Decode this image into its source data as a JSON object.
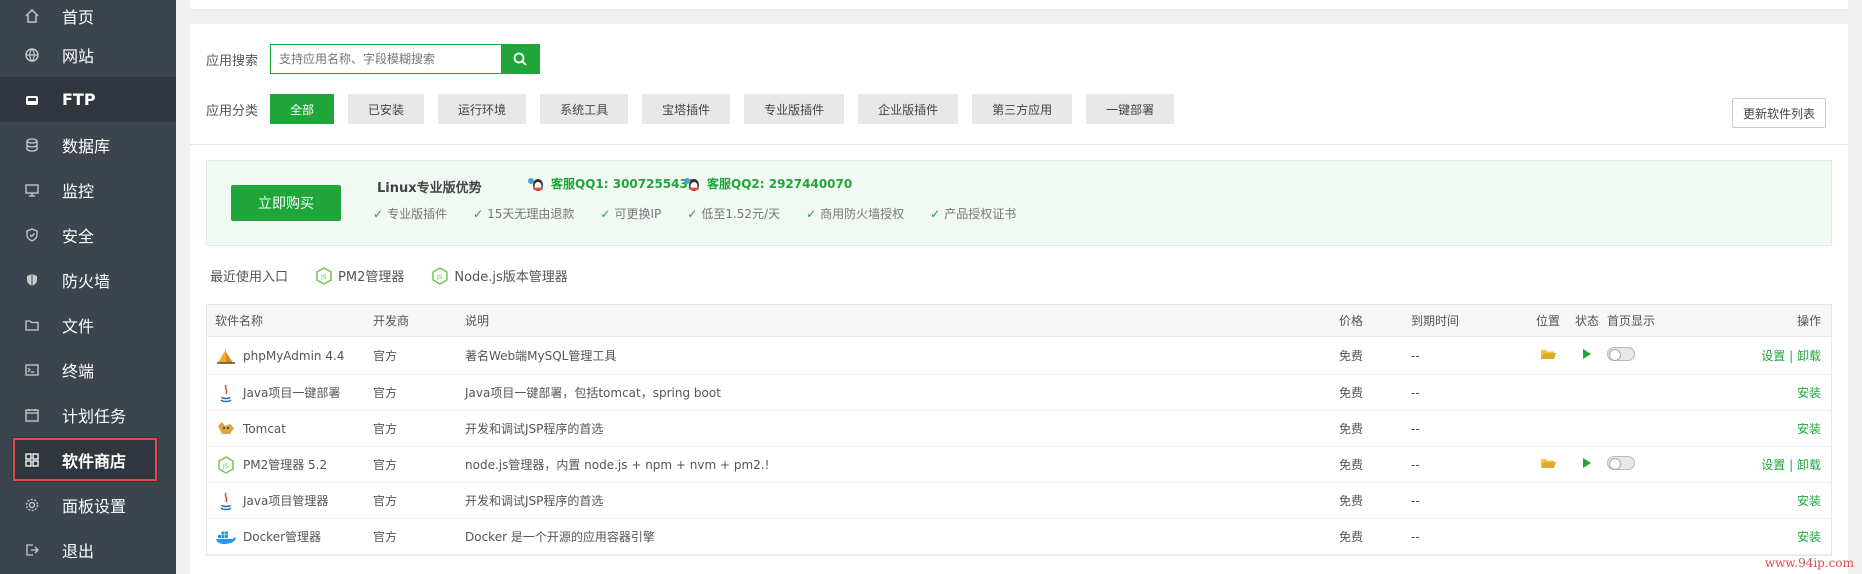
{
  "sidebar": {
    "items": [
      {
        "label": "首页",
        "icon": "home-icon"
      },
      {
        "label": "网站",
        "icon": "globe-icon"
      },
      {
        "label": "FTP",
        "icon": "ftp-icon"
      },
      {
        "label": "数据库",
        "icon": "database-icon"
      },
      {
        "label": "监控",
        "icon": "monitor-icon"
      },
      {
        "label": "安全",
        "icon": "shield-icon"
      },
      {
        "label": "防火墙",
        "icon": "firewall-icon"
      },
      {
        "label": "文件",
        "icon": "folder-icon"
      },
      {
        "label": "终端",
        "icon": "terminal-icon"
      },
      {
        "label": "计划任务",
        "icon": "calendar-icon"
      },
      {
        "label": "软件商店",
        "icon": "grid-icon"
      },
      {
        "label": "面板设置",
        "icon": "gear-icon"
      },
      {
        "label": "退出",
        "icon": "logout-icon"
      }
    ]
  },
  "search": {
    "label": "应用搜索",
    "placeholder": "支持应用名称、字段模糊搜索"
  },
  "categories": {
    "label": "应用分类",
    "items": [
      "全部",
      "已安装",
      "运行环境",
      "系统工具",
      "宝塔插件",
      "专业版插件",
      "企业版插件",
      "第三方应用",
      "一键部署"
    ],
    "selected": "全部"
  },
  "refresh_label": "更新软件列表",
  "promo": {
    "buy_label": "立即购买",
    "title": "Linux专业版优势",
    "qq1": "客服QQ1: 3007255432",
    "qq2": "客服QQ2: 2927440070",
    "perks": [
      "专业版插件",
      "15天无理由退款",
      "可更换IP",
      "低至1.52元/天",
      "商用防火墙授权",
      "产品授权证书"
    ]
  },
  "recent": {
    "label": "最近使用入口",
    "items": [
      "PM2管理器",
      "Node.js版本管理器"
    ]
  },
  "table": {
    "headers": {
      "name": "软件名称",
      "dev": "开发商",
      "desc": "说明",
      "price": "价格",
      "expire": "到期时间",
      "pos": "位置",
      "state": "状态",
      "home": "首页显示",
      "op": "操作"
    },
    "rows": [
      {
        "name": "phpMyAdmin 4.4",
        "dev": "官方",
        "desc": "著名Web端MySQL管理工具",
        "price": "免费",
        "expire": "--",
        "installed": true,
        "op1": "设置",
        "sep": "|",
        "op2": "卸载"
      },
      {
        "name": "Java项目一键部署",
        "dev": "官方",
        "desc": "Java项目一键部署，包括tomcat，spring boot",
        "price": "免费",
        "expire": "--",
        "installed": false,
        "op1": "安装"
      },
      {
        "name": "Tomcat",
        "dev": "官方",
        "desc": "开发和调试JSP程序的首选",
        "price": "免费",
        "expire": "--",
        "installed": false,
        "op1": "安装"
      },
      {
        "name": "PM2管理器 5.2",
        "dev": "官方",
        "desc": "node.js管理器，内置 node.js + npm + nvm + pm2.!",
        "price": "免费",
        "expire": "--",
        "installed": true,
        "op1": "设置",
        "sep": "|",
        "op2": "卸载"
      },
      {
        "name": "Java项目管理器",
        "dev": "官方",
        "desc": "开发和调试JSP程序的首选",
        "price": "免费",
        "expire": "--",
        "installed": false,
        "op1": "安装"
      },
      {
        "name": "Docker管理器",
        "dev": "官方",
        "desc": "Docker 是一个开源的应用容器引擎",
        "price": "免费",
        "expire": "--",
        "installed": false,
        "op1": "安装"
      }
    ]
  },
  "watermark": "www.94ip.com",
  "colors": {
    "accent": "#20a53a",
    "sidebar": "#3c444d",
    "highlight": "#e34a4a"
  }
}
